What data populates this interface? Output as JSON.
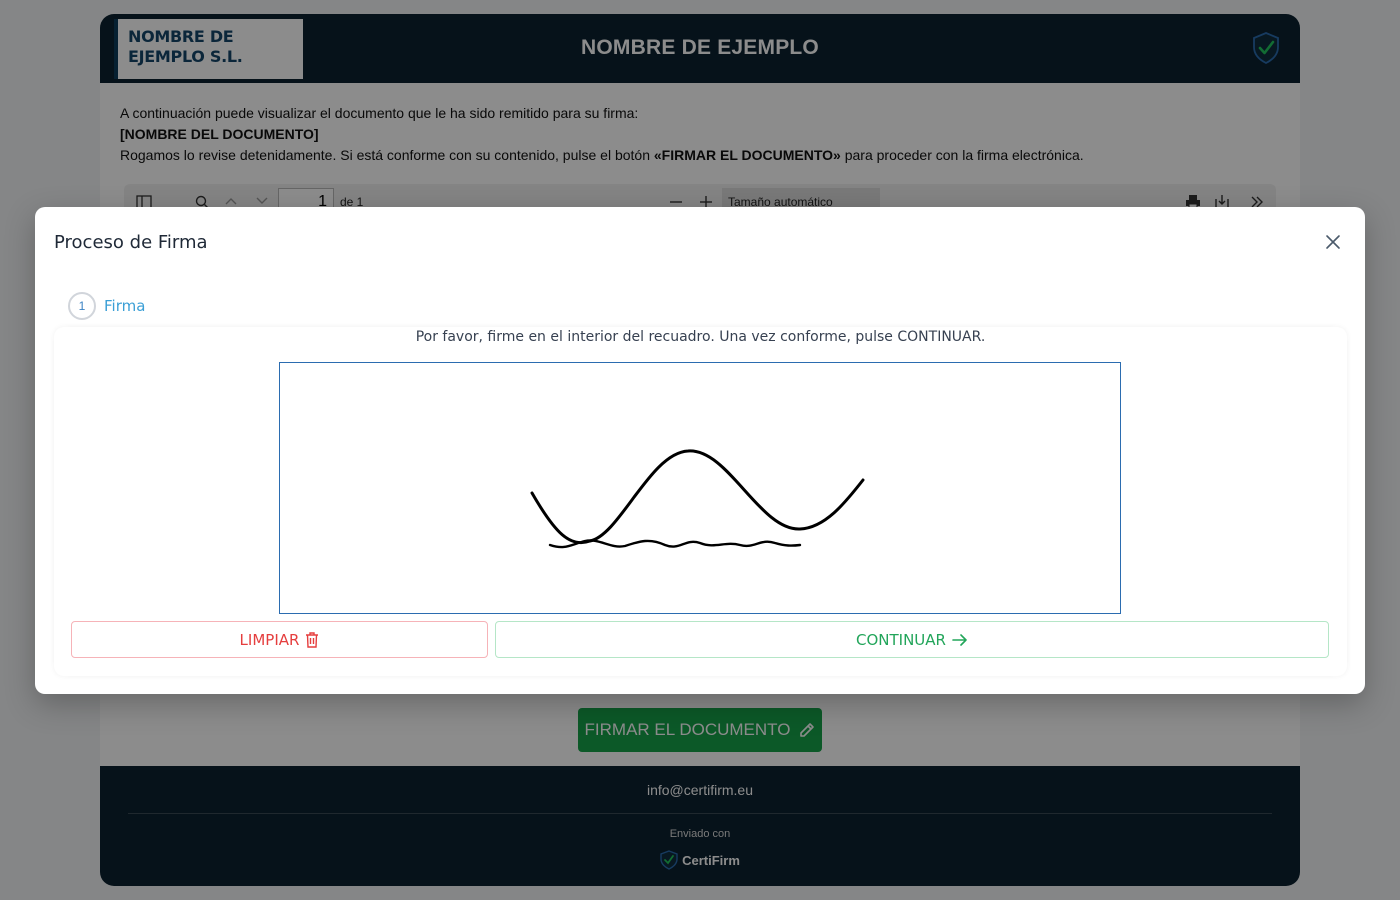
{
  "header": {
    "logo_line1": "NOMBRE DE",
    "logo_line2": "EJEMPLO S.L.",
    "title": "NOMBRE DE EJEMPLO"
  },
  "intro": {
    "line1": "A continuación puede visualizar el documento que le ha sido remitido para su firma:",
    "doc_name": "[NOMBRE DEL DOCUMENTO]",
    "line3_pre": "Rogamos lo revise detenidamente. Si está conforme con su contenido, pulse el botón ",
    "line3_bold": "«FIRMAR EL DOCUMENTO»",
    "line3_post": " para proceder con la firma electrónica."
  },
  "pdf_toolbar": {
    "page_value": "1",
    "page_of": "de 1",
    "zoom_selected": "Tamaño automático"
  },
  "sign_document_button": "FIRMAR EL DOCUMENTO",
  "footer": {
    "email": "info@certifirm.eu",
    "sent_with": "Enviado con",
    "brand": "CertiFirm"
  },
  "modal": {
    "title": "Proceso de Firma",
    "step_number": "1",
    "step_label": "Firma",
    "instruction": "Por favor, firme en el interior del recuadro. Una vez conforme, pulse CONTINUAR.",
    "clear_label": "LIMPIAR",
    "continue_label": "CONTINUAR"
  },
  "colors": {
    "header_bg": "#0c2230",
    "primary_green": "#16a34a",
    "clear_red": "#e53e3e",
    "signature_border": "#2b6cb0"
  },
  "icons": {
    "header": "shield-check-icon",
    "close": "close-icon",
    "clear": "trash-icon",
    "continue": "arrow-right-icon",
    "sign": "pencil-icon"
  }
}
